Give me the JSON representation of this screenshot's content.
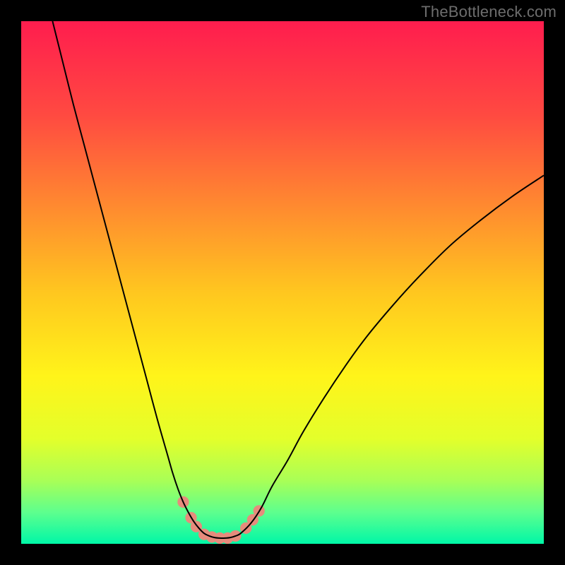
{
  "watermark": "TheBottleneck.com",
  "chart_data": {
    "type": "line",
    "title": "",
    "xlabel": "",
    "ylabel": "",
    "xlim": [
      0,
      100
    ],
    "ylim": [
      0,
      100
    ],
    "grid": false,
    "legend": false,
    "background_gradient_stops": [
      {
        "pct": 0,
        "color": "#ff1d4e"
      },
      {
        "pct": 18,
        "color": "#ff4a41"
      },
      {
        "pct": 36,
        "color": "#ff8c2f"
      },
      {
        "pct": 52,
        "color": "#ffc71f"
      },
      {
        "pct": 68,
        "color": "#fff41a"
      },
      {
        "pct": 80,
        "color": "#e3ff2b"
      },
      {
        "pct": 88,
        "color": "#a8ff57"
      },
      {
        "pct": 94,
        "color": "#5dff8e"
      },
      {
        "pct": 100,
        "color": "#00f7a7"
      }
    ],
    "series": [
      {
        "name": "curve-left",
        "stroke": "#000000",
        "x": [
          6.0,
          8.0,
          10.0,
          12.0,
          14.0,
          16.0,
          18.0,
          20.0,
          22.0,
          24.0,
          26.0,
          28.0,
          29.0,
          30.0,
          31.0,
          32.0,
          33.0,
          34.0,
          35.0,
          36.0
        ],
        "y": [
          100.0,
          92.0,
          84.0,
          76.5,
          69.0,
          61.5,
          54.0,
          46.5,
          39.0,
          31.5,
          24.0,
          17.0,
          13.5,
          10.5,
          8.0,
          6.0,
          4.3,
          3.0,
          2.0,
          1.5
        ]
      },
      {
        "name": "notch-floor",
        "stroke": "#000000",
        "x": [
          36.0,
          37.0,
          38.0,
          39.0,
          40.0,
          41.0,
          42.0
        ],
        "y": [
          1.5,
          1.2,
          1.1,
          1.1,
          1.2,
          1.5,
          2.0
        ]
      },
      {
        "name": "curve-right",
        "stroke": "#000000",
        "x": [
          42.0,
          44.0,
          46.0,
          48.0,
          51.0,
          54.0,
          58.0,
          62.0,
          66.0,
          71.0,
          76.0,
          82.0,
          88.0,
          94.0,
          100.0
        ],
        "y": [
          2.0,
          4.0,
          7.0,
          11.0,
          16.0,
          21.5,
          28.0,
          34.0,
          39.5,
          45.5,
          51.0,
          57.0,
          62.0,
          66.5,
          70.5
        ]
      }
    ],
    "markers": [
      {
        "x": 31.0,
        "y": 8.0,
        "r": 1.1,
        "color": "#e68b7c"
      },
      {
        "x": 32.5,
        "y": 5.0,
        "r": 1.1,
        "color": "#e68b7c"
      },
      {
        "x": 33.5,
        "y": 3.3,
        "r": 1.1,
        "color": "#e68b7c"
      },
      {
        "x": 35.0,
        "y": 1.8,
        "r": 1.1,
        "color": "#e68b7c"
      },
      {
        "x": 36.5,
        "y": 1.3,
        "r": 1.1,
        "color": "#e68b7c"
      },
      {
        "x": 38.0,
        "y": 1.1,
        "r": 1.1,
        "color": "#e68b7c"
      },
      {
        "x": 39.5,
        "y": 1.1,
        "r": 1.1,
        "color": "#e68b7c"
      },
      {
        "x": 41.0,
        "y": 1.5,
        "r": 1.1,
        "color": "#e68b7c"
      },
      {
        "x": 43.0,
        "y": 3.0,
        "r": 1.1,
        "color": "#e68b7c"
      },
      {
        "x": 44.3,
        "y": 4.6,
        "r": 1.1,
        "color": "#e68b7c"
      },
      {
        "x": 45.5,
        "y": 6.3,
        "r": 1.1,
        "color": "#e68b7c"
      }
    ]
  }
}
